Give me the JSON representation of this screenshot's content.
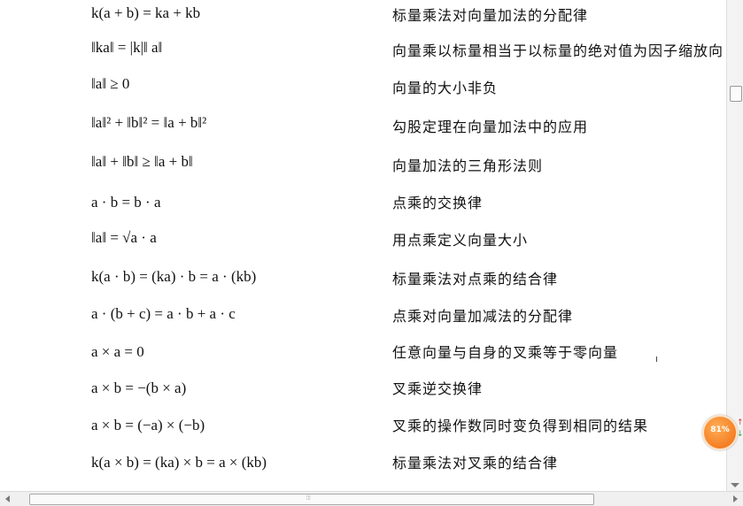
{
  "rows": [
    {
      "formula": "k(a + b) = ka + kb",
      "description": "标量乘法对向量加法的分配律"
    },
    {
      "formula": "‖ka‖ = |k|‖ a‖",
      "description": "向量乘以标量相当于以标量的绝对值为因子缩放向"
    },
    {
      "formula": "‖a‖ ≥ 0",
      "description": "向量的大小非负"
    },
    {
      "formula": "‖a‖² + ‖b‖² = ‖a + b‖²",
      "description": "勾股定理在向量加法中的应用"
    },
    {
      "formula": "‖a‖ + ‖b‖ ≥ ‖a + b‖",
      "description": "向量加法的三角形法则"
    },
    {
      "formula": "a · b = b · a",
      "description": "点乘的交换律"
    },
    {
      "formula": "‖a‖ = √a · a",
      "description": "用点乘定义向量大小"
    },
    {
      "formula": "k(a · b) = (ka) · b = a · (kb)",
      "description": "标量乘法对点乘的结合律"
    },
    {
      "formula": "a · (b + c) = a · b + a · c",
      "description": "点乘对向量加减法的分配律"
    },
    {
      "formula": "a × a = 0",
      "description": "任意向量与自身的叉乘等于零向量"
    },
    {
      "formula": "a × b = −(b × a)",
      "description": "叉乘逆交换律"
    },
    {
      "formula": "a × b = (−a) × (−b)",
      "description": "叉乘的操作数同时变负得到相同的结果"
    },
    {
      "formula": "k(a × b) = (ka) × b = a × (kb)",
      "description": "标量乘法对叉乘的结合律"
    }
  ],
  "zoom": {
    "level": "81%",
    "color": "#f07a20"
  },
  "scrollbars": {
    "horizontal_grip": "⦙⦙⦙"
  }
}
